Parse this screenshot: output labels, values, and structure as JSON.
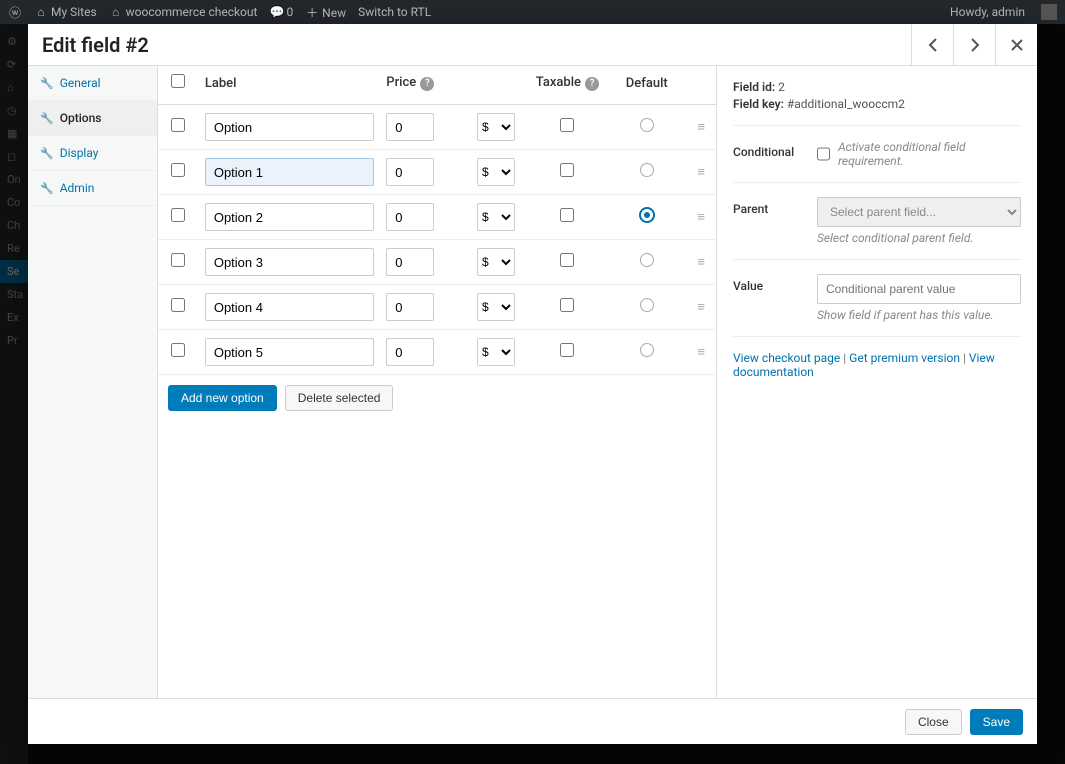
{
  "wpbar": {
    "mysites": "My Sites",
    "sitename": "woocommerce checkout",
    "comments": "0",
    "new": "New",
    "rtl": "Switch to RTL",
    "howdy": "Howdy, admin"
  },
  "sidebar_hints": [
    "On",
    "Co",
    "Ch",
    "Re",
    "Se",
    "Sta",
    "Ex",
    "Pr"
  ],
  "modal": {
    "title": "Edit field #2",
    "tabs": {
      "general": "General",
      "options": "Options",
      "display": "Display",
      "admin": "Admin"
    },
    "headers": {
      "label": "Label",
      "price": "Price",
      "taxable": "Taxable",
      "default": "Default"
    },
    "rows": [
      {
        "label": "Option",
        "price": "0",
        "currency": "$",
        "taxable": false,
        "default": false,
        "highlight": false
      },
      {
        "label": "Option 1",
        "price": "0",
        "currency": "$",
        "taxable": false,
        "default": false,
        "highlight": true
      },
      {
        "label": "Option 2",
        "price": "0",
        "currency": "$",
        "taxable": false,
        "default": true,
        "highlight": false
      },
      {
        "label": "Option 3",
        "price": "0",
        "currency": "$",
        "taxable": false,
        "default": false,
        "highlight": false
      },
      {
        "label": "Option 4",
        "price": "0",
        "currency": "$",
        "taxable": false,
        "default": false,
        "highlight": false
      },
      {
        "label": "Option 5",
        "price": "0",
        "currency": "$",
        "taxable": false,
        "default": false,
        "highlight": false
      }
    ],
    "buttons": {
      "add": "Add new option",
      "delete": "Delete selected",
      "close": "Close",
      "save": "Save"
    },
    "meta": {
      "field_id_label": "Field id:",
      "field_id": "2",
      "field_key_label": "Field key:",
      "field_key": "#additional_wooccm2"
    },
    "conditional": {
      "label": "Conditional",
      "activate": "Activate conditional field requirement.",
      "parent_label": "Parent",
      "parent_placeholder": "Select parent field...",
      "parent_help": "Select conditional parent field.",
      "value_label": "Value",
      "value_placeholder": "Conditional parent value",
      "value_help": "Show field if parent has this value."
    },
    "links": {
      "view": "View checkout page",
      "premium": "Get premium version",
      "docs": "View documentation"
    }
  }
}
